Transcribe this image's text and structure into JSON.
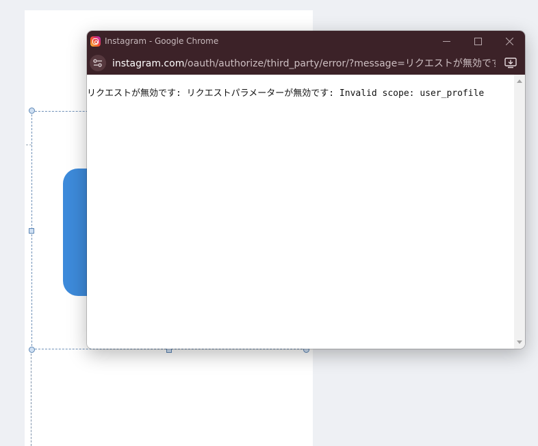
{
  "window": {
    "title": "Instagram - Google Chrome",
    "minimize_label": "—",
    "maximize_label": "☐",
    "close_label": "✕"
  },
  "address_bar": {
    "host": "instagram.com",
    "path": "/oauth/authorize/third_party/error/?message=リクエストが無効です%3A%20..."
  },
  "content": {
    "message": "リクエストが無効です: リクエストパラメーターが無効です: Invalid scope: user_profile"
  },
  "colors": {
    "titlebar": "#3c2228",
    "shape_blue": "#3d8ada"
  }
}
